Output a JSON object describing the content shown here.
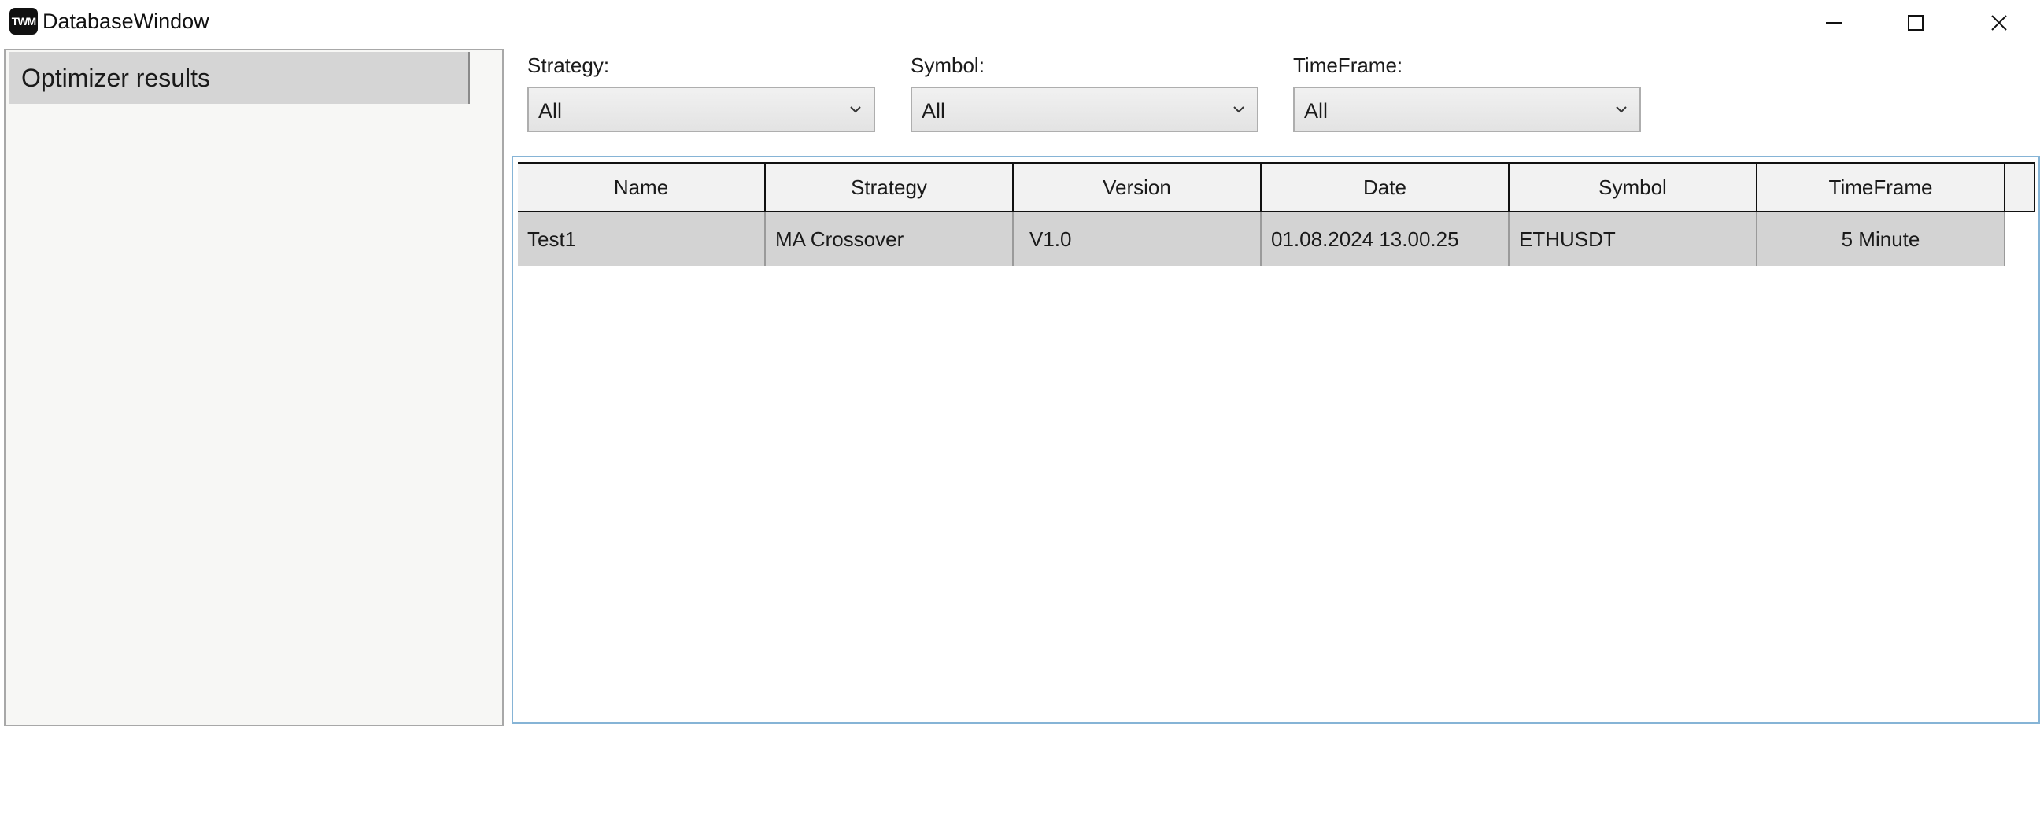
{
  "window": {
    "title": "DatabaseWindow",
    "icon_text": "TWM"
  },
  "left_panel": {
    "items": [
      {
        "label": "Optimizer results"
      }
    ]
  },
  "filters": {
    "strategy": {
      "label": "Strategy:",
      "value": "All"
    },
    "symbol": {
      "label": "Symbol:",
      "value": "All"
    },
    "timeframe": {
      "label": "TimeFrame:",
      "value": "All"
    }
  },
  "grid": {
    "columns": [
      "Name",
      "Strategy",
      "Version",
      "Date",
      "Symbol",
      "TimeFrame"
    ],
    "rows": [
      [
        "Test1",
        "MA Crossover",
        "V1.0",
        "01.08.2024 13.00.25",
        "ETHUSDT",
        "5 Minute"
      ]
    ]
  },
  "icons": {
    "minimize": "minimize-icon",
    "maximize": "maximize-icon",
    "close": "close-icon",
    "dropdown": "chevron-down-icon"
  },
  "colors": {
    "selected_row": "#d3d3d3",
    "grid_border": "#86b4d6",
    "panel_background": "#f7f7f5"
  }
}
